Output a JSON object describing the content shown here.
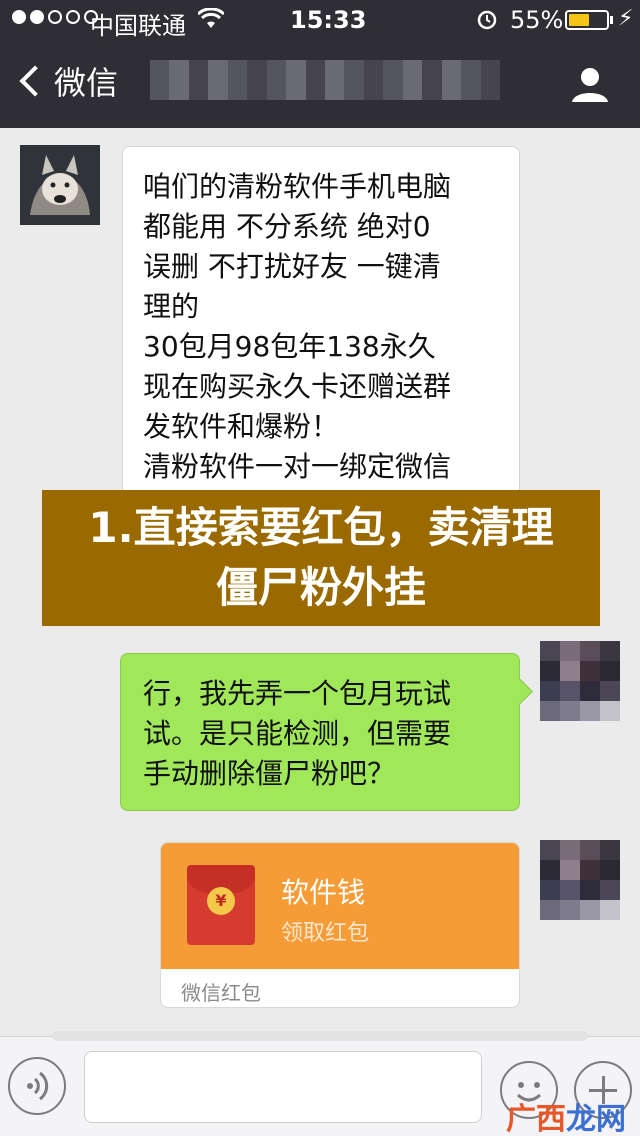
{
  "status_bar": {
    "carrier": "中国联通",
    "time": "15:33",
    "battery_percent": "55%",
    "battery_level": 0.55,
    "icons": [
      "signal-dots-icon",
      "wifi-icon",
      "alarm-icon",
      "battery-icon",
      "charging-bolt-icon"
    ]
  },
  "nav": {
    "back_label": "微信",
    "back_icon": "chevron-left-icon",
    "profile_icon": "person-icon"
  },
  "messages": {
    "incoming_lines": [
      "咱们的清粉软件手机电脑",
      "都能用 不分系统 绝对0",
      "误删 不打扰好友 一键清",
      "理的",
      "30包月98包年138永久",
      "现在购买永久卡还赠送群",
      "发软件和爆粉！",
      "清粉软件一对一绑定微信"
    ],
    "outgoing_lines": [
      "行，我先弄一个包月玩试",
      "试。是只能检测，但需要",
      "手动删除僵尸粉吧？"
    ]
  },
  "banner": {
    "line1": "1.直接索要红包，卖清理",
    "line2": "僵尸粉外挂"
  },
  "red_packet": {
    "title": "软件钱",
    "subtitle": "领取红包",
    "footer": "微信红包",
    "coin_symbol": "¥"
  },
  "input_bar": {
    "icons": [
      "voice-icon",
      "emoji-icon",
      "plus-icon"
    ]
  },
  "watermark": {
    "part1": "广西",
    "part2": "龙网"
  },
  "colors": {
    "navbar": "#2e2e34",
    "chat_background": "#ebebeb",
    "outgoing_bubble": "#a0e75a",
    "banner": "#9a6a00",
    "red_packet": "#f59c36"
  }
}
